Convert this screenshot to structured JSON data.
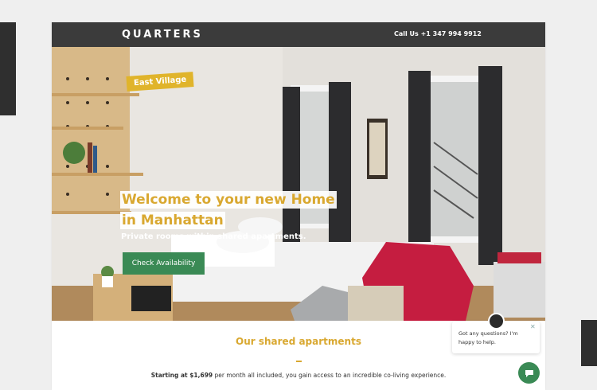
{
  "header": {
    "logo": "QUARTERS",
    "phone": "Call Us +1 347 994 9912"
  },
  "hero": {
    "tag": "East Village",
    "headline_line1": "Welcome to your new Home",
    "headline_line2": "in Manhattan",
    "subheadline": "Private rooms within shared apartments.",
    "cta_label": "Check Availability"
  },
  "section": {
    "title": "Our shared apartments",
    "intro_bold": "Starting at $1,699",
    "intro_rest": " per month all included, you gain access to an incredible co-living experience."
  },
  "chat": {
    "message": "Got any questions? I'm happy to help.",
    "close_icon": "close-icon",
    "button_icon": "chat-icon"
  },
  "colors": {
    "accent": "#d9a830",
    "cta": "#3a8a55",
    "topbar": "#3b3b3b"
  }
}
